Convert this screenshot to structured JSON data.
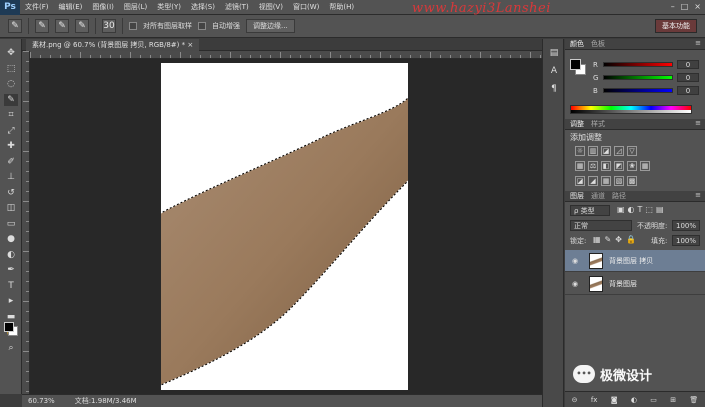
{
  "app": {
    "logo": "Ps",
    "menu": [
      "文件(F)",
      "编辑(E)",
      "图像(I)",
      "图层(L)",
      "类型(Y)",
      "选择(S)",
      "滤镜(T)",
      "视图(V)",
      "窗口(W)",
      "帮助(H)"
    ],
    "watermark": "www.hazyi3Lanshei",
    "window_controls": [
      "–",
      "□",
      "×"
    ]
  },
  "options": {
    "tool_glyph": "✎",
    "size_value": "30",
    "sample_all_label": "对所有图层取样",
    "auto_enhance_label": "自动增强",
    "refine_edge_label": "调整边缘...",
    "workspace_label": "基本功能"
  },
  "document": {
    "tab_title": "素材.png @ 60.7% (背景图层 拷贝, RGB/8#) *  ×",
    "zoom": "60.73%",
    "doc_size": "文档:1.98M/3.46M"
  },
  "tools": [
    {
      "name": "move-tool",
      "glyph": "✥"
    },
    {
      "name": "marquee-tool",
      "glyph": "⬚"
    },
    {
      "name": "lasso-tool",
      "glyph": "◌"
    },
    {
      "name": "quick-selection-tool",
      "glyph": "✎"
    },
    {
      "name": "crop-tool",
      "glyph": "⌗"
    },
    {
      "name": "eyedropper-tool",
      "glyph": "⤢"
    },
    {
      "name": "healing-brush-tool",
      "glyph": "✚"
    },
    {
      "name": "brush-tool",
      "glyph": "✐"
    },
    {
      "name": "clone-stamp-tool",
      "glyph": "⊥"
    },
    {
      "name": "history-brush-tool",
      "glyph": "↺"
    },
    {
      "name": "eraser-tool",
      "glyph": "◫"
    },
    {
      "name": "gradient-tool",
      "glyph": "▭"
    },
    {
      "name": "blur-tool",
      "glyph": "●"
    },
    {
      "name": "dodge-tool",
      "glyph": "◐"
    },
    {
      "name": "pen-tool",
      "glyph": "✒"
    },
    {
      "name": "type-tool",
      "glyph": "T"
    },
    {
      "name": "path-selection-tool",
      "glyph": "▸"
    },
    {
      "name": "shape-tool",
      "glyph": "▬"
    },
    {
      "name": "hand-tool",
      "glyph": "✋"
    },
    {
      "name": "zoom-tool",
      "glyph": "⌕"
    }
  ],
  "color_panel": {
    "tabs": [
      "颜色",
      "色板"
    ],
    "channels": [
      {
        "label": "R",
        "value": "0",
        "gradient": "linear-gradient(to right,#000,#f00)"
      },
      {
        "label": "G",
        "value": "0",
        "gradient": "linear-gradient(to right,#000,#0f0)"
      },
      {
        "label": "B",
        "value": "0",
        "gradient": "linear-gradient(to right,#000,#00f)"
      }
    ]
  },
  "adjustments_panel": {
    "tabs": [
      "调整",
      "样式"
    ],
    "title": "添加调整",
    "row1": [
      "☼",
      "▥",
      "◪",
      "◿",
      "▽"
    ],
    "row2": [
      "▦",
      "⚖",
      "◧",
      "◩",
      "❀",
      "▦"
    ],
    "row3": [
      "◪",
      "◢",
      "▦",
      "▧",
      "▩"
    ]
  },
  "layers_panel": {
    "tabs": [
      "图层",
      "通道",
      "路径"
    ],
    "kind_filter": "ρ 类型",
    "blend_mode": "正常",
    "opacity_label": "不透明度:",
    "opacity_value": "100%",
    "lock_label": "锁定:",
    "fill_label": "填充:",
    "fill_value": "100%",
    "layers": [
      {
        "name": "背景图层 拷贝",
        "selected": true
      },
      {
        "name": "背景图层",
        "selected": false
      }
    ],
    "footer_icons": [
      "⊝",
      "fx",
      "◙",
      "◐",
      "▭",
      "⊞",
      "🗑"
    ]
  },
  "wechat_watermark": {
    "text": "极微设计"
  }
}
